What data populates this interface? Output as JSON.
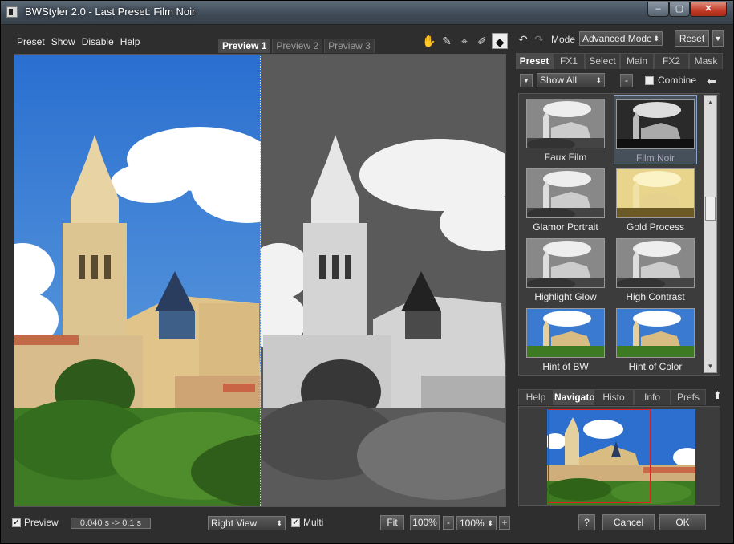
{
  "window": {
    "title": "BWStyler 2.0 - Last Preset: Film Noir",
    "min": "–",
    "max": "▢",
    "close": "✕"
  },
  "menu": [
    "Preset",
    "Show",
    "Disable",
    "Help"
  ],
  "preview_tabs": [
    "Preview 1",
    "Preview 2",
    "Preview 3"
  ],
  "mode": {
    "label": "Mode",
    "value": "Advanced Mode",
    "reset": "Reset"
  },
  "panel_tabs": [
    "Preset",
    "FX1",
    "Select",
    "Main",
    "FX2",
    "Mask"
  ],
  "filter": {
    "value": "Show All",
    "minus": "-",
    "combine": "Combine"
  },
  "presets": [
    {
      "name": "Faux Film",
      "style": "bw"
    },
    {
      "name": "Film Noir",
      "style": "noir",
      "selected": true
    },
    {
      "name": "Glamor Portrait",
      "style": "bw"
    },
    {
      "name": "Gold Process",
      "style": "gold"
    },
    {
      "name": "Highlight Glow",
      "style": "bw"
    },
    {
      "name": "High Contrast",
      "style": "bw"
    },
    {
      "name": "Hint of BW",
      "style": "color"
    },
    {
      "name": "Hint of Color",
      "style": "color"
    }
  ],
  "bottom_tabs": [
    "Help",
    "Navigato",
    "Histo",
    "Info",
    "Prefs"
  ],
  "status": {
    "preview_label": "Preview",
    "timing": "0.040 s -> 0.1 s",
    "view": "Right View",
    "multi": "Multi",
    "fit": "Fit",
    "zoom1": "100%",
    "minus": "-",
    "zoom2": "100%",
    "plus": "+",
    "help": "?",
    "cancel": "Cancel",
    "ok": "OK"
  }
}
